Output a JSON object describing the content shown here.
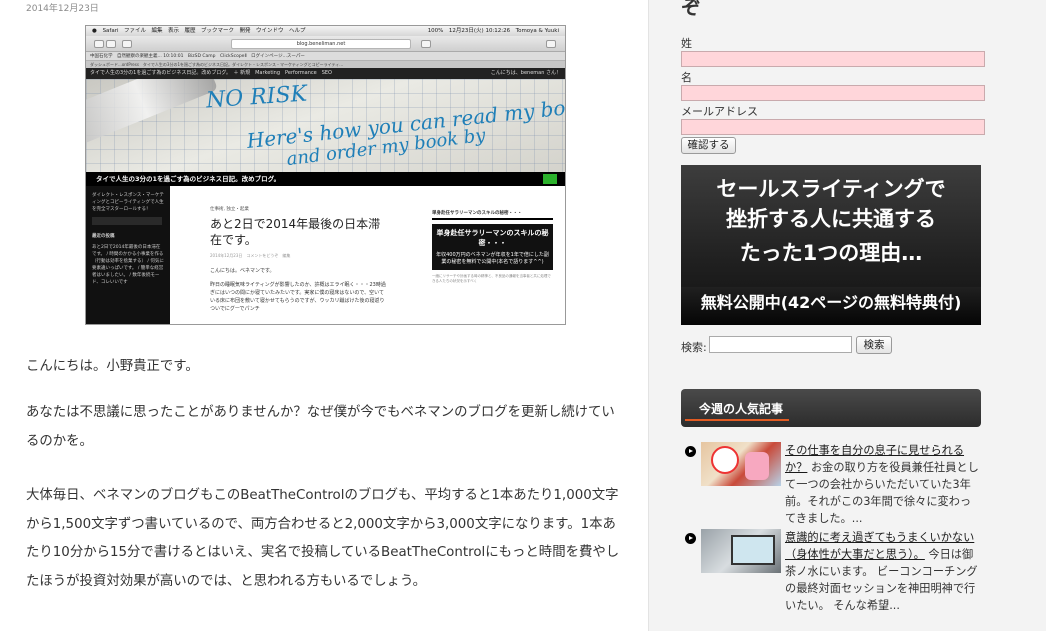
{
  "post": {
    "date": "2014年12月23日",
    "paragraphs": [
      "こんにちは。小野貴正です。",
      "あなたは不思議に思ったことがありませんか？なぜ僕が今でもベネマンのブログを更新し続けているのかを。",
      "大体毎日、ベネマンのブログもこのBeatTheControlのブログも、平均すると1本あたり1,000文字から1,500文字ずつ書いているので、両方合わせると2,000文字から3,000文字になります。1本あたり10分から15分で書けるとはいえ、実名で投稿しているBeatTheControlにもっと時間を費やしたほうが投資対効果が高いのでは、と思われる方もいるでしょう。"
    ]
  },
  "screenshot": {
    "menubar_left": "Safari　ファイル　編集　表示　履歴　ブックマーク　開発　ウインドウ　ヘルプ",
    "menubar_right": "100%　12月23日(火) 10:12:26　Tomoya & Yuuki",
    "url": "blog.beneliman.net",
    "bookmarks": "中国石化学　自然観察の楽観主義... 10:10:01　BizSD Camp　ClickScopeⅡ　ログインページ...スーパー",
    "tabs": "ダッシュボード...ordPress　タイで人生の3分の1を過ごす為のビジネス日記。ダイレクト・レスポンス・マーケティングとコピーライティ...",
    "adminbar": "タイで人生の3分の1を過ごす為のビジネス日記。改めブログ。　＋ 新規　Marketing　Performance　SEO",
    "adminbar_right": "こんにちは、beneman さん！",
    "hand1": "NO RISK",
    "hand2": "Here's how you can read my book",
    "hand3": "and order my book by",
    "site_title": "タイで人生の3分の1を過ごす為のビジネス日記。改めブログ。",
    "left_desc": "ダイレクト・レスポンス・マーケティングとコピーライティングで人生を完全マスターロールする！",
    "left_heading": "最近の投稿",
    "left_items": "あと2日で2014年最後の日本滞在です。 / 時間のかかる小事業を作る（行動は効率を捨業する） / 何気に要素違いっぱいです。 / 簡単な経営者はいましたい。 / 数年後続モード、コレいいです",
    "mid_cat": "仕事術, 独立・起業",
    "mid_title": "あと2日で2014年最後の日本滞在です。",
    "mid_meta": "2014年12月23日　コメントをどうぞ　編集",
    "mid_p1": "こんにちは。ベネマンです。",
    "mid_p2": "昨日の睡眠気味ライティングが影響したのか、許概はエライ眠く・・・23時過ぎにはいつの間にか寝ていたみたいです。実家に僕の寝床はないので、空いている床に布団を敷いて寝かせてもらうのですが、ウッカリ蹴ばけた後の寝返りついでにグーでパンチ",
    "right_heading": "単身赴任サラリーマンのスキルの秘密・・・",
    "right_ad": "単身赴任サラリーマンのスキルの秘密・・・",
    "right_ad_small": "年収400万円のベネマンが年収を1年で倍にした副業の秘密を無料で公開中(本名で語ります^^)",
    "right_fine": "一緒にリサーチや計画する時の精神と、不良品の通報を当事者と共に処理できる人たちの状況を示すべく"
  },
  "form": {
    "top_char": "ぞ",
    "last_name_label": "姓",
    "first_name_label": "名",
    "email_label": "メールアドレス",
    "confirm_button": "確認する"
  },
  "banner": {
    "line1": "セールスライティングで",
    "line2": "挫折する人に共通する",
    "line3": "たった1つの理由…",
    "line4": "無料公開中(42ページの無料特典付)"
  },
  "search": {
    "label": "検索:",
    "button": "検索"
  },
  "popular": {
    "title": "今週の人気記事",
    "items": [
      {
        "link": "その仕事を自分の息子に見せられるか？",
        "excerpt": " お金の取り方を役員兼任社員として一つの会社からいただいていた3年前。それがこの3年間で徐々に変わってきました。..."
      },
      {
        "link": "意識的に考え過ぎてもうまくいかない（身体性が大事だと思う）。",
        "excerpt": " 今日は御茶ノ水にいます。 ビーコンコーチングの最終対面セッションを神田明神で行いたい。 そんな希望..."
      }
    ]
  },
  "colors": {
    "input_pink": "#ffd6da",
    "accent_orange": "#e25b22",
    "banner_bg": "#202020"
  }
}
